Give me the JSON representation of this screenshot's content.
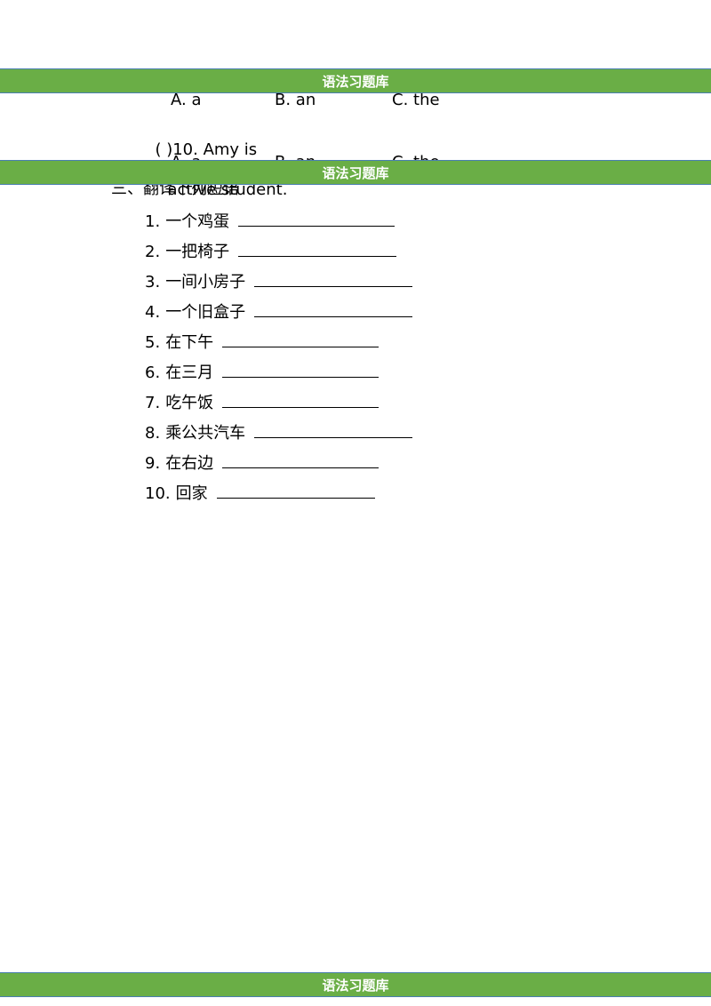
{
  "header": {
    "title": "语法习题库"
  },
  "footer": {
    "title": "语法习题库"
  },
  "section_banner": {
    "title": "语法习题库"
  },
  "q9_options": {
    "a": "A. a",
    "b": "B. an",
    "c": "C. the"
  },
  "q10": {
    "prefix": "( )10. Amy is",
    "suffix": "active student."
  },
  "q10_options": {
    "a": "A. a",
    "b": "B. an",
    "c": "C. the"
  },
  "section3": {
    "title": "三、翻译下列短语"
  },
  "phrases": [
    {
      "num": "1.",
      "text": "一个鸡蛋"
    },
    {
      "num": "2.",
      "text": "一把椅子"
    },
    {
      "num": "3.",
      "text": "一间小房子"
    },
    {
      "num": "4.",
      "text": "一个旧盒子"
    },
    {
      "num": "5.",
      "text": "在下午"
    },
    {
      "num": "6.",
      "text": "在三月"
    },
    {
      "num": "7.",
      "text": "吃午饭"
    },
    {
      "num": "8.",
      "text": "乘公共汽车"
    },
    {
      "num": "9.",
      "text": "在右边"
    },
    {
      "num": "10.",
      "text": "回家"
    }
  ]
}
